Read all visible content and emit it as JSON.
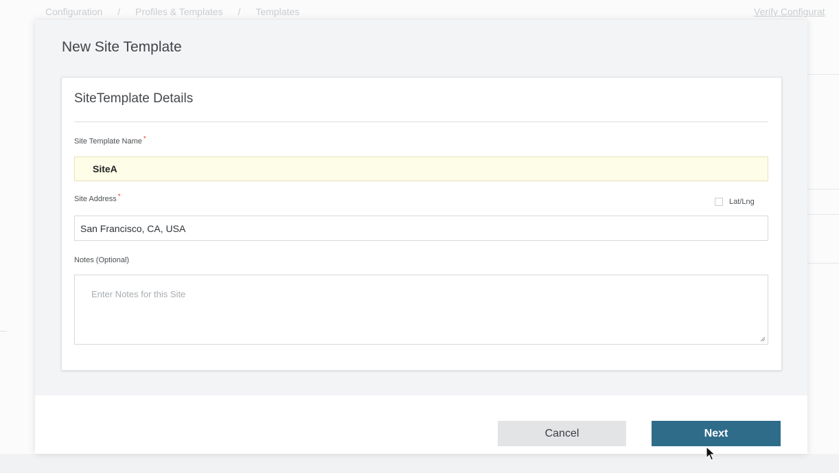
{
  "background": {
    "breadcrumb": [
      "Configuration",
      "Profiles & Templates",
      "Templates"
    ],
    "separator": "/",
    "verify_link": "Verify Configurat"
  },
  "modal": {
    "title": "New Site Template",
    "card_title": "SiteTemplate Details",
    "fields": {
      "name": {
        "label": "Site Template Name",
        "required_mark": "*",
        "value": "SiteA"
      },
      "address": {
        "label": "Site Address",
        "required_mark": "*",
        "value": "San Francisco, CA, USA",
        "latlng_label": "Lat/Lng"
      },
      "notes": {
        "label": "Notes (Optional)",
        "placeholder": "Enter Notes for this Site",
        "value": ""
      }
    },
    "buttons": {
      "cancel": "Cancel",
      "next": "Next"
    }
  },
  "colors": {
    "primary": "#2e6c8a",
    "required": "#e0453a",
    "autofill": "#fdfde8"
  }
}
